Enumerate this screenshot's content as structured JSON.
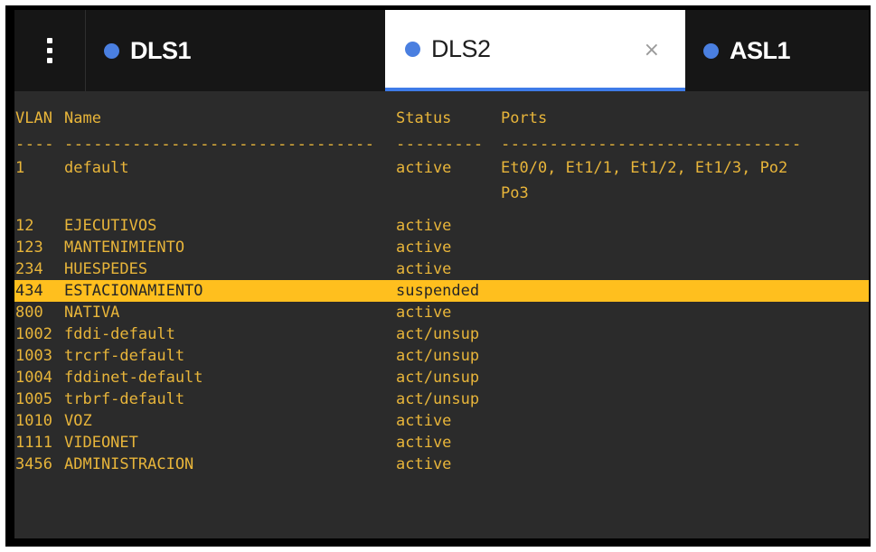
{
  "tabs": [
    {
      "label": "DLS1",
      "active": false
    },
    {
      "label": "DLS2",
      "active": true,
      "close": "×"
    },
    {
      "label": "ASL1",
      "active": false
    }
  ],
  "colors": {
    "terminal_bg": "#2b2b2b",
    "terminal_text": "#e8b53a",
    "highlight": "#ffbf1e",
    "tab_dot": "#4a7fe0",
    "active_tab_underline": "#3e7be8"
  },
  "table": {
    "header": {
      "vlan": "VLAN",
      "name": "Name",
      "status": "Status",
      "ports": "Ports"
    },
    "dashes": {
      "vlan": "----",
      "name": "--------------------------------",
      "status": "---------",
      "ports": "-------------------------------"
    },
    "rows": [
      {
        "vlan": "1",
        "name": "default",
        "status": "active",
        "ports": "Et0/0, Et1/1, Et1/2, Et1/3, Po2",
        "ports_cont": "Po3"
      },
      {
        "vlan": "12",
        "name": "EJECUTIVOS",
        "status": "active"
      },
      {
        "vlan": "123",
        "name": "MANTENIMIENTO",
        "status": "active"
      },
      {
        "vlan": "234",
        "name": "HUESPEDES",
        "status": "active"
      },
      {
        "vlan": "434",
        "name": "ESTACIONAMIENTO",
        "status": "suspended",
        "highlighted": true
      },
      {
        "vlan": "800",
        "name": "NATIVA",
        "status": "active"
      },
      {
        "vlan": "1002",
        "name": "fddi-default",
        "status": "act/unsup"
      },
      {
        "vlan": "1003",
        "name": "trcrf-default",
        "status": "act/unsup"
      },
      {
        "vlan": "1004",
        "name": "fddinet-default",
        "status": "act/unsup"
      },
      {
        "vlan": "1005",
        "name": "trbrf-default",
        "status": "act/unsup"
      },
      {
        "vlan": "1010",
        "name": "VOZ",
        "status": "active"
      },
      {
        "vlan": "1111",
        "name": "VIDEONET",
        "status": "active"
      },
      {
        "vlan": "3456",
        "name": "ADMINISTRACION",
        "status": "active"
      }
    ]
  }
}
